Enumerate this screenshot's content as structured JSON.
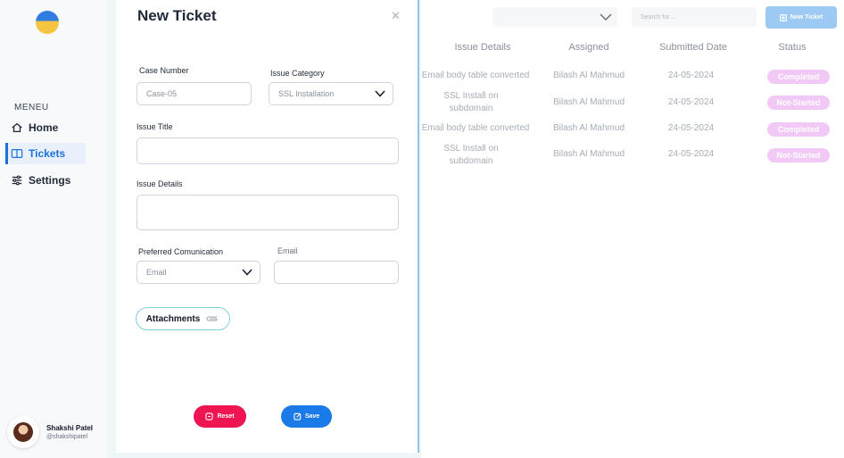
{
  "sidebar": {
    "menu_title": "MENEU",
    "items": [
      {
        "label": "Home"
      },
      {
        "label": "Tickets"
      },
      {
        "label": "Settings"
      }
    ],
    "profile": {
      "name": "Shakshi Patel",
      "handle": "@shakshipatel"
    }
  },
  "form": {
    "title": "New Ticket",
    "close_icon": "close-icon",
    "case_number": {
      "label": "Case Number",
      "placeholder": "Case-05"
    },
    "issue_category": {
      "label": "Issue Category",
      "value": "SSL Installation"
    },
    "issue_title": {
      "label": "Issue Title",
      "value": ""
    },
    "issue_details": {
      "label": "Issue Details",
      "value": ""
    },
    "preferred_communication": {
      "label": "Preferred Comunication",
      "value": "Email"
    },
    "email": {
      "label": "Email",
      "value": ""
    },
    "attachments_label": "Attachments",
    "reset_label": "Reset",
    "save_label": "Save"
  },
  "toolbar": {
    "search_placeholder": "Search for...",
    "new_ticket_label": "New Ticket"
  },
  "table": {
    "headers": [
      "Issue Details",
      "Assigned",
      "Submitted Date",
      "Status"
    ],
    "rows": [
      {
        "details_1": "Email body table converted",
        "details_2": "",
        "assigned": "Bilash Al Mahmud",
        "date": "24-05-2024",
        "status": "Completed"
      },
      {
        "details_1": "SSL Install on",
        "details_2": "subdomain",
        "assigned": "Bilash Al Mahmud",
        "date": "24-05-2024",
        "status": "Not-Started"
      },
      {
        "details_1": "Email body table converted",
        "details_2": "",
        "assigned": "Bilash Al Mahmud",
        "date": "24-05-2024",
        "status": "Completed"
      },
      {
        "details_1": "SSL Install on",
        "details_2": "subdomain",
        "assigned": "Bilash Al Mahmud",
        "date": "24-05-2024",
        "status": "Not-Started"
      }
    ]
  },
  "colors": {
    "accent": "#1e6fd9",
    "reset": "#ef1553",
    "save": "#1a7ae8",
    "status_badge": "#f1c8f6"
  }
}
